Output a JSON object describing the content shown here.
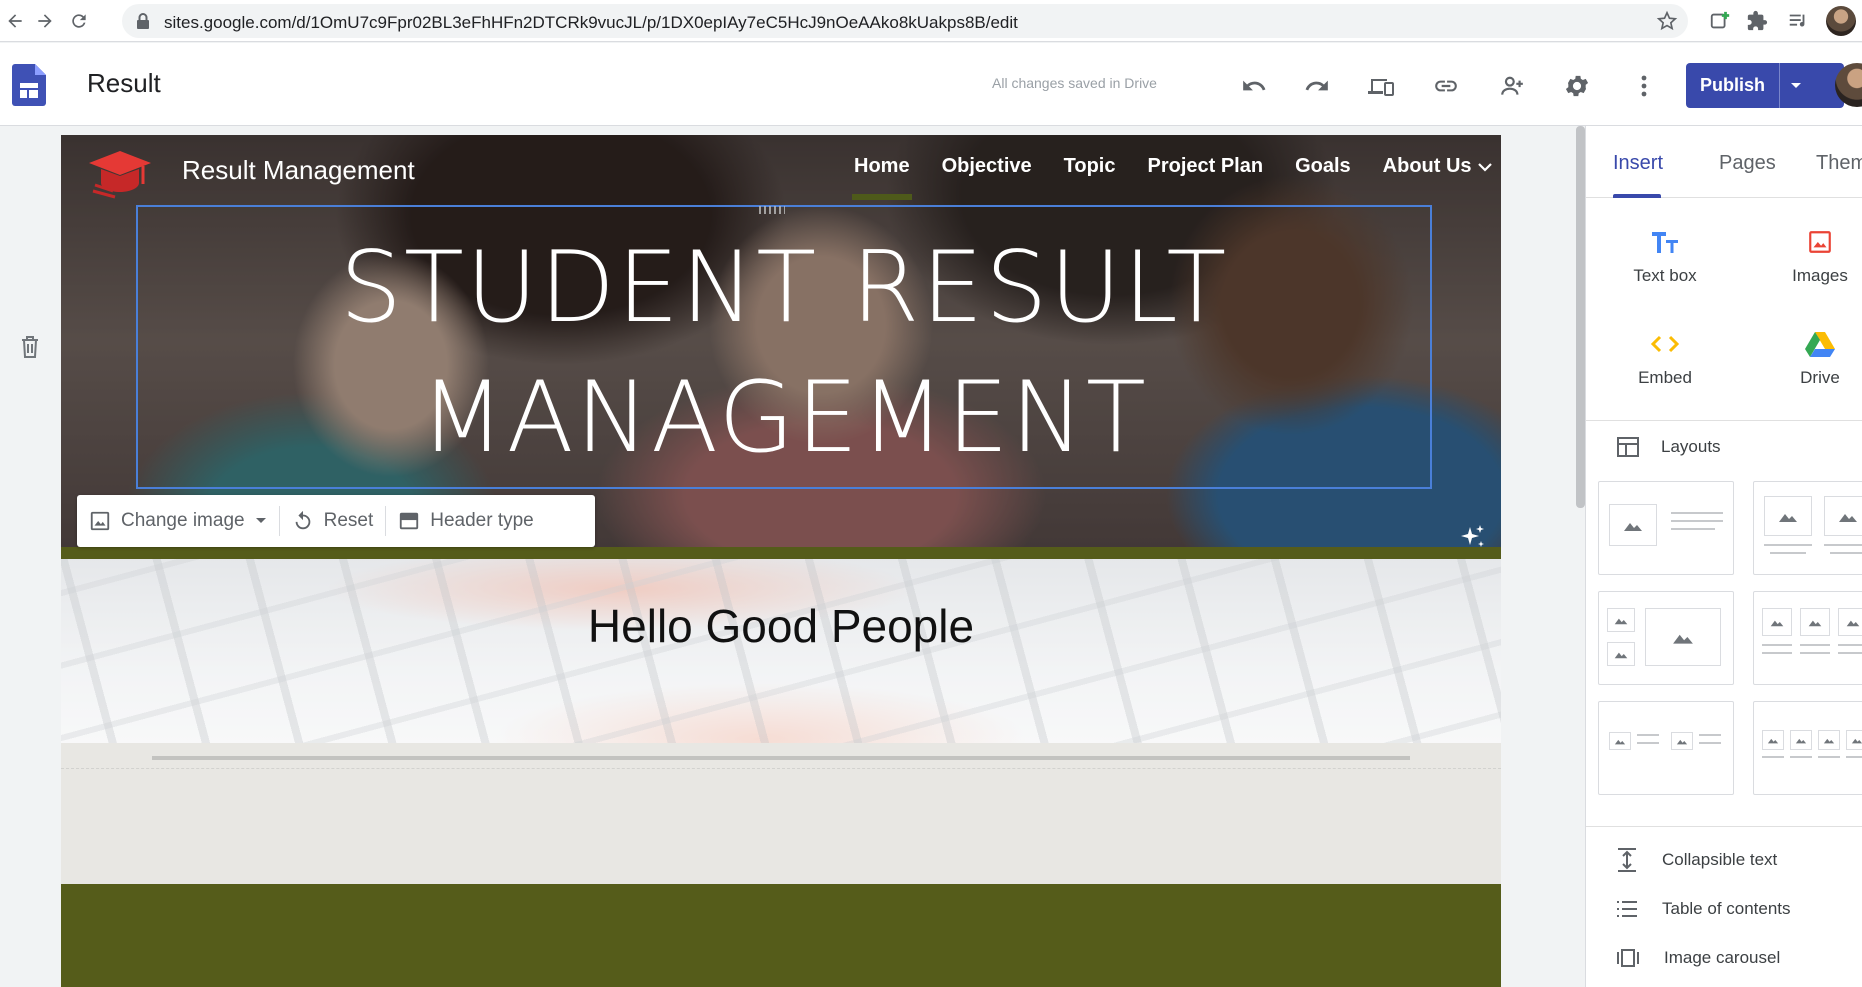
{
  "browser": {
    "url": "sites.google.com/d/1OmU7c9Fpr02BL3eFhHFn2DTCRk9vucJL/p/1DX0epIAy7eC5HcJ9nOeAAko8kUakps8B/edit"
  },
  "app": {
    "title": "Result",
    "saved_status": "All changes saved in Drive",
    "publish_label": "Publish"
  },
  "site": {
    "name": "Result Management",
    "nav": [
      {
        "label": "Home",
        "active": true
      },
      {
        "label": "Objective"
      },
      {
        "label": "Topic"
      },
      {
        "label": "Project Plan"
      },
      {
        "label": "Goals"
      },
      {
        "label": "About Us"
      }
    ],
    "hero_title_line1": "STUDENT RESULT",
    "hero_title_line2": "MANAGEMENT",
    "toolbar": {
      "change_image": "Change image",
      "reset": "Reset",
      "header_type": "Header type"
    },
    "section_heading": "Hello Good People"
  },
  "panel": {
    "tabs": [
      "Insert",
      "Pages",
      "Them"
    ],
    "insert_items": [
      "Text box",
      "Images",
      "Embed",
      "Drive"
    ],
    "layouts_label": "Layouts",
    "list_items": [
      "Collapsible text",
      "Table of contents",
      "Image carousel"
    ]
  },
  "colors": {
    "accent": "#3949ab",
    "olive": "#555c1a",
    "selection": "#4a7fd8"
  }
}
